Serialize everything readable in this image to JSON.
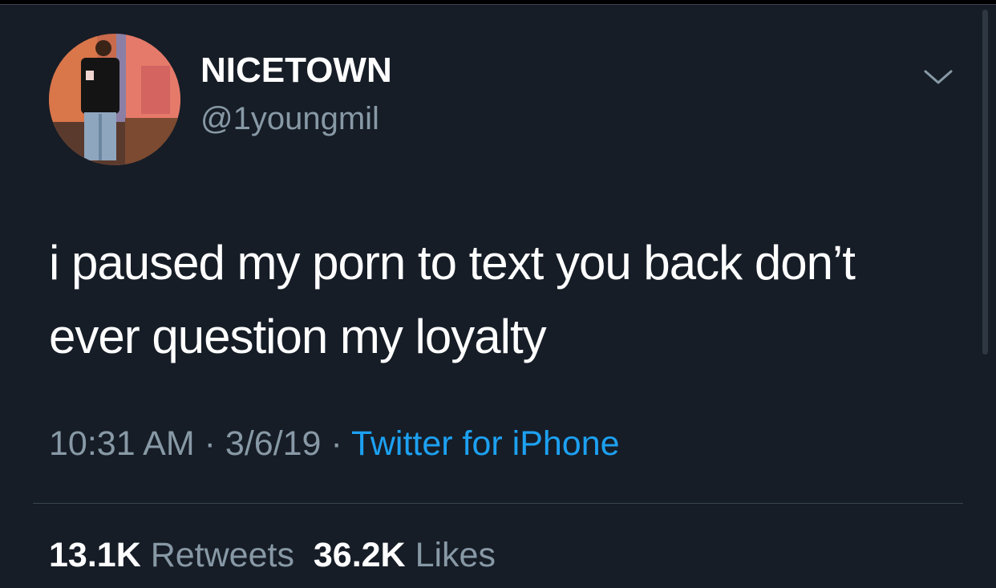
{
  "user": {
    "display_name": "NICETOWN",
    "handle": "@1youngmil"
  },
  "tweet": {
    "text": "i paused my porn to text you back don’t ever question my loyalty",
    "time": "10:31 AM",
    "date": "3/6/19",
    "separator": "·",
    "source": "Twitter for iPhone"
  },
  "stats": {
    "retweets_count": "13.1K",
    "retweets_label": "Retweets",
    "likes_count": "36.2K",
    "likes_label": "Likes"
  },
  "icons": {
    "menu": "chevron-down-icon",
    "avatar": "avatar-photo"
  },
  "colors": {
    "background": "#161d27",
    "primary_text": "#ffffff",
    "secondary_text": "#8899a6",
    "link": "#1da1f2",
    "divider": "#38444d"
  }
}
